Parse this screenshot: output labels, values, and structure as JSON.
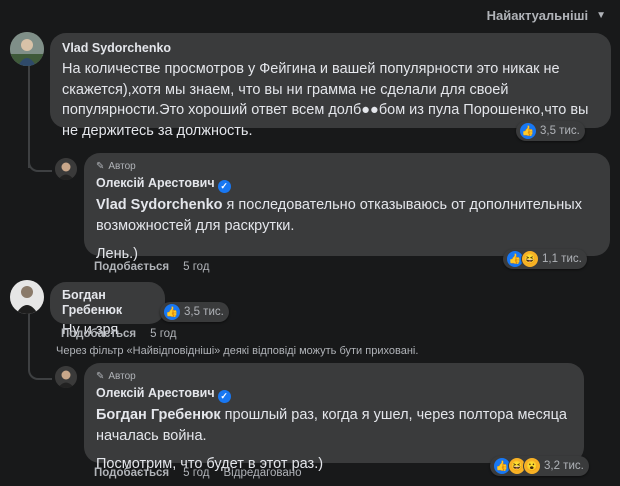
{
  "sort": {
    "label": "Найактуальніші"
  },
  "comments": [
    {
      "author": "Vlad Sydorchenko",
      "text": "На количестве просмотров у Фейгина и вашей популярности это никак не скажется),хотя мы знаем, что вы ни грамма не сделали для своей популярности.Это хороший ответ всем долб●●бом из пула Порошенко,что вы не держитесь за должность.",
      "reactions_count": "3,5 тис."
    },
    {
      "badge": "Автор",
      "author": "Олексій Арестович",
      "mention": "Vlad Sydorchenko",
      "text": " я последовательно отказываюсь от дополнительных возможностей для раскрутки.",
      "text2": "Лень.)",
      "like_label": "Подобається",
      "time": "5 год",
      "reactions_count": "1,1 тис."
    },
    {
      "author": "Богдан Гребенюк",
      "text": "Ну и зря",
      "reactions_count": "3,5 тис.",
      "like_label": "Подобається",
      "time": "5 год"
    },
    {
      "badge": "Автор",
      "author": "Олексій Арестович",
      "mention": "Богдан Гребенюк",
      "text": " прошлый раз, когда я ушел, через полтора месяца началась война.",
      "text2": "Посмотрим, что будет в этот раз.)",
      "like_label": "Подобається",
      "time": "5 год",
      "edited": "Відредаговано",
      "reactions_count": "3,2 тис."
    }
  ],
  "filter_note": "Через фільтр «Найвідповідніші» деякі відповіді можуть бути приховані.",
  "colors": {
    "background": "#18191a",
    "bubble": "#3a3b3c",
    "like": "#1877f2",
    "haha": "#f7b125"
  }
}
